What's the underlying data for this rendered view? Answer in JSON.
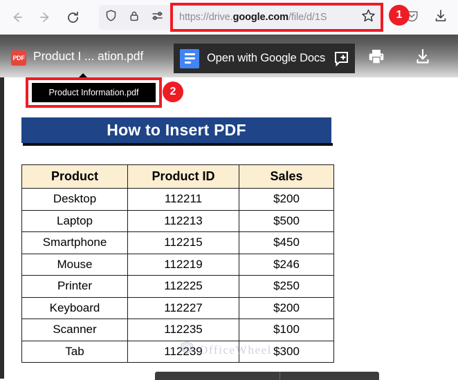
{
  "browser": {
    "back_icon": "back-arrow-icon",
    "forward_icon": "forward-arrow-icon",
    "reload_icon": "reload-icon",
    "shield_icon": "shield-icon",
    "lock_icon": "lock-icon",
    "permissions_icon": "permissions-icon",
    "url": "https://drive.google.com/file/d/1S",
    "url_prefix": "https://drive.",
    "url_domain": "google.com",
    "url_suffix": "/file/d/1S",
    "star_icon": "bookmark-star-icon",
    "pocket_icon": "pocket-icon",
    "downloads_icon": "downloads-icon"
  },
  "annotations": {
    "badge_1": "1",
    "badge_2": "2",
    "accent_color": "#ee1c25"
  },
  "viewer": {
    "file_type_label": "PDF",
    "file_title": "Product I ... ation.pdf",
    "open_with_label": "Open with Google Docs",
    "gdocs_icon": "google-docs-icon",
    "comment_icon": "add-comment-icon",
    "print_icon": "print-icon",
    "download_icon": "download-icon",
    "tooltip_text": "Product Information.pdf"
  },
  "document": {
    "banner_title": "How to Insert PDF",
    "banner_color": "#1f4487",
    "header_fill": "#fceed1",
    "watermark_text": "OfficeWheel",
    "watermark_logo": "officewheel-logo-icon"
  },
  "chart_data": {
    "type": "table",
    "title": "How to Insert PDF",
    "columns": [
      "Product",
      "Product ID",
      "Sales"
    ],
    "rows": [
      [
        "Desktop",
        "112211",
        "$200"
      ],
      [
        "Laptop",
        "112213",
        "$500"
      ],
      [
        "Smartphone",
        "112215",
        "$450"
      ],
      [
        "Mouse",
        "112219",
        "$246"
      ],
      [
        "Printer",
        "112225",
        "$250"
      ],
      [
        "Keyboard",
        "112227",
        "$200"
      ],
      [
        "Scanner",
        "112235",
        "$100"
      ],
      [
        "Tab",
        "112239",
        "$300"
      ]
    ]
  }
}
